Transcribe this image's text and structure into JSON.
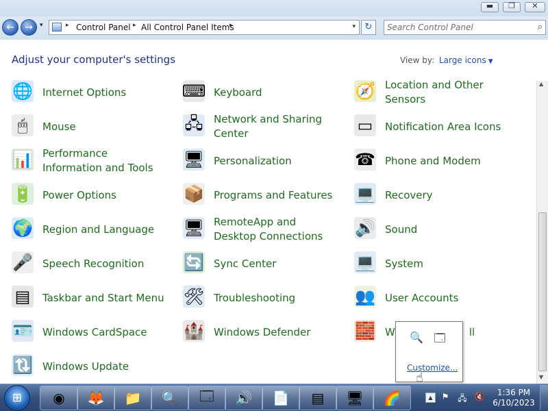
{
  "window": {
    "buttons": {
      "minimize": "▬",
      "maximize": "❐",
      "close": "✕"
    }
  },
  "nav": {
    "back": "←",
    "forward": "→",
    "dropdown": "▾",
    "breadcrumb": [
      "Control Panel",
      "All Control Panel Items"
    ],
    "separator": "▸",
    "refresh": "↻",
    "search_placeholder": "Search Control Panel",
    "search_icon": "⌕"
  },
  "header": {
    "title": "Adjust your computer's settings",
    "view_by_label": "View by:",
    "view_by_value": "Large icons",
    "view_by_caret": "▼"
  },
  "items": [
    {
      "label": "Internet Options",
      "icon": "internet-options-icon",
      "glyph": "🌐"
    },
    {
      "label": "Keyboard",
      "icon": "keyboard-icon",
      "glyph": "⌨"
    },
    {
      "label": "Location and Other Sensors",
      "icon": "location-sensors-icon",
      "glyph": "🧭"
    },
    {
      "label": "Mouse",
      "icon": "mouse-icon",
      "glyph": "🖱"
    },
    {
      "label": "Network and Sharing Center",
      "icon": "network-icon",
      "glyph": "🖧"
    },
    {
      "label": "Notification Area Icons",
      "icon": "notification-area-icon",
      "glyph": "▭"
    },
    {
      "label": "Performance Information and Tools",
      "icon": "performance-icon",
      "glyph": "📊"
    },
    {
      "label": "Personalization",
      "icon": "personalization-icon",
      "glyph": "🖥"
    },
    {
      "label": "Phone and Modem",
      "icon": "phone-modem-icon",
      "glyph": "☎"
    },
    {
      "label": "Power Options",
      "icon": "power-options-icon",
      "glyph": "🔋"
    },
    {
      "label": "Programs and Features",
      "icon": "programs-features-icon",
      "glyph": "📦"
    },
    {
      "label": "Recovery",
      "icon": "recovery-icon",
      "glyph": "💻"
    },
    {
      "label": "Region and Language",
      "icon": "region-language-icon",
      "glyph": "🌍"
    },
    {
      "label": "RemoteApp and Desktop Connections",
      "icon": "remoteapp-icon",
      "glyph": "🖥"
    },
    {
      "label": "Sound",
      "icon": "sound-icon",
      "glyph": "🔊"
    },
    {
      "label": "Speech Recognition",
      "icon": "microphone-icon",
      "glyph": "🎤"
    },
    {
      "label": "Sync Center",
      "icon": "sync-center-icon",
      "glyph": "🔄"
    },
    {
      "label": "System",
      "icon": "system-icon",
      "glyph": "💻"
    },
    {
      "label": "Taskbar and Start Menu",
      "icon": "taskbar-icon",
      "glyph": "▤"
    },
    {
      "label": "Troubleshooting",
      "icon": "troubleshooting-icon",
      "glyph": "🛠"
    },
    {
      "label": "User Accounts",
      "icon": "user-accounts-icon",
      "glyph": "👥"
    },
    {
      "label": "Windows CardSpace",
      "icon": "cardspace-icon",
      "glyph": "🪪"
    },
    {
      "label": "Windows Defender",
      "icon": "defender-icon",
      "glyph": "🏰"
    },
    {
      "label": "Windows Firewall",
      "label_visible": "W",
      "label_tail": "ll",
      "icon": "firewall-icon",
      "glyph": "🧱"
    },
    {
      "label": "Windows Update",
      "icon": "windows-update-icon",
      "glyph": "🔃"
    }
  ],
  "scrollbar": {
    "up": "▲",
    "down": "▼"
  },
  "taskbar": {
    "start": "⊞",
    "apps": [
      {
        "name": "chrome",
        "glyph": "◉"
      },
      {
        "name": "firefox",
        "glyph": "🦊"
      },
      {
        "name": "explorer",
        "glyph": "📁"
      },
      {
        "name": "search",
        "glyph": "🔍"
      },
      {
        "name": "control-panel",
        "glyph": "🗔"
      },
      {
        "name": "sound",
        "glyph": "🔊"
      },
      {
        "name": "notepad",
        "glyph": "📄"
      },
      {
        "name": "taskbar-settings",
        "glyph": "▤"
      },
      {
        "name": "personalization",
        "glyph": "🖥"
      },
      {
        "name": "display",
        "glyph": "🌈"
      }
    ],
    "tray_up": "▲",
    "tray_icons": [
      "⚑",
      "🖧",
      "🔇"
    ],
    "time": "1:36 PM",
    "date": "6/10/2023"
  },
  "popup": {
    "icons": [
      "🔍",
      "🗔"
    ],
    "customize": "Customize..."
  },
  "cursor": "☝"
}
